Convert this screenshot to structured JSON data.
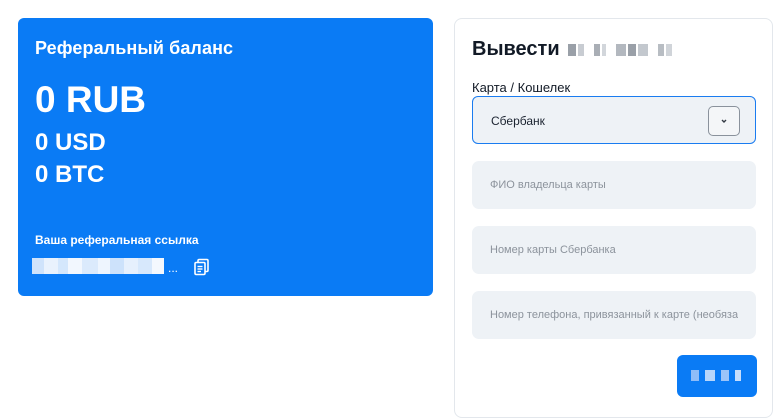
{
  "referral": {
    "title": "Реферальный баланс",
    "balance_rub": "0 RUB",
    "balance_usd": "0 USD",
    "balance_btc": "0 BTC",
    "link_label": "Ваша реферальная ссылка",
    "link_ellipsis": "...",
    "copy_icon": "copy-icon"
  },
  "withdraw": {
    "title": "Вывести",
    "method_label": "Карта / Кошелек",
    "method_selected": "Сбербанк",
    "name_placeholder": "ФИО владельца карты",
    "card_placeholder": "Номер карты Сбербанка",
    "phone_placeholder": "Номер телефона, привязанный к карте (необязательно)",
    "dropdown_icon": "chevron-down-icon"
  },
  "colors": {
    "accent": "#0a7bf5",
    "input_bg": "#eef2f6",
    "placeholder": "#8c939c"
  }
}
